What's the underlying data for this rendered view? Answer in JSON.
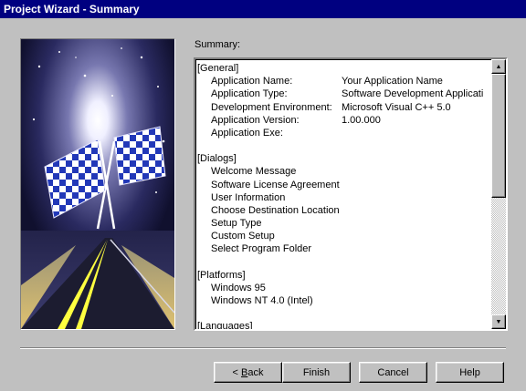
{
  "window": {
    "title": "Project Wizard - Summary"
  },
  "summary_label": "Summary:",
  "sections": {
    "general": {
      "header": "[General]",
      "rows": [
        {
          "key": "Application Name:",
          "value": "Your Application Name"
        },
        {
          "key": "Application Type:",
          "value": "Software Development Applicati"
        },
        {
          "key": "Development Environment:",
          "value": "Microsoft Visual C++ 5.0"
        },
        {
          "key": "Application Version:",
          "value": "1.00.000"
        },
        {
          "key": "Application Exe:",
          "value": ""
        }
      ]
    },
    "dialogs": {
      "header": "[Dialogs]",
      "items": [
        "Welcome Message",
        "Software License Agreement",
        "User Information",
        "Choose Destination Location",
        "Setup Type",
        "Custom Setup",
        "Select Program Folder"
      ]
    },
    "platforms": {
      "header": "[Platforms]",
      "items": [
        "Windows 95",
        "Windows NT 4.0 (Intel)"
      ]
    },
    "languages": {
      "header": "[Languages]"
    }
  },
  "buttons": {
    "back_prefix": "< ",
    "back_accel": "B",
    "back_rest": "ack",
    "finish": "Finish",
    "cancel": "Cancel",
    "help": "Help"
  },
  "icons": {
    "scroll_up": "scroll-up-arrow-icon",
    "scroll_down": "scroll-down-arrow-icon",
    "banner": "checkered-flags-road-image"
  },
  "colors": {
    "titlebar": "#000080",
    "dialog": "#c0c0c0"
  }
}
